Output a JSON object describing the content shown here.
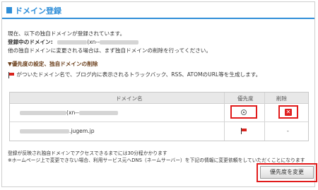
{
  "title": "ドメイン登録",
  "intro": {
    "line1": "現在、以下の独自ドメインが登録されています。",
    "registering_label": "登録中のドメイン:",
    "registering_suffix": "(xn--",
    "line3": "他の独自ドメインに変更される場合は、まず独自ドメインの削除を行ってください。"
  },
  "priority_section": {
    "heading": "▼優先度の設定、独自ドメインの削除",
    "description": "がついたドメイン名で、ブログ内に表示されるトラックバック、RSS、ATOMのURL等を生成します。"
  },
  "table": {
    "headers": [
      "ドメイン名",
      "優先度",
      "削除"
    ],
    "rows": [
      {
        "domain_suffix": "(xn--",
        "priority": "radio-selected",
        "delete": "delete-icon"
      },
      {
        "domain_suffix": ".jugem.jp",
        "priority": "flag-icon",
        "delete": "-"
      }
    ]
  },
  "notes": {
    "line1": "登録が反映され独自ドメインでアクセスできるまでには30分程かかります",
    "line2": "※ホームページ上で変更できない場合、利用サービス元へDNS（ネームサーバー）を下記の情報に変更依頼をしていただくことになります"
  },
  "button": {
    "label": "優先度を変更"
  },
  "colors": {
    "accent": "#2f8ed8",
    "highlight": "#e11b1b",
    "section_heading": "#6b3f1b",
    "flag": "#d9231d"
  }
}
